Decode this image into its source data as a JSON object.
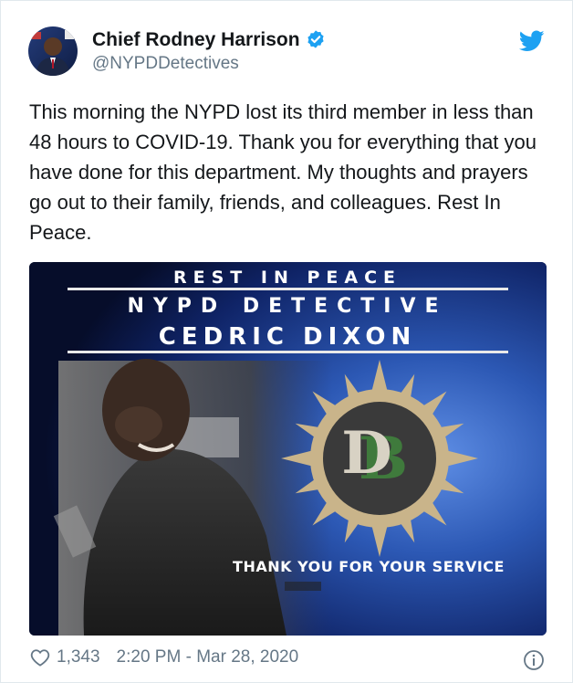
{
  "tweet": {
    "author": {
      "display_name": "Chief Rodney Harrison",
      "handle": "@NYPDDetectives",
      "verified": true,
      "avatar_icon": "profile-photo"
    },
    "brand_icon": "twitter-bird-icon",
    "text": "This morning the NYPD lost its third member in less than 48 hours to COVID-19. Thank you for everything that you have done for this department. My thoughts and prayers go out to their family, friends, and colleagues. Rest In Peace.",
    "media": {
      "line1": "REST IN PEACE",
      "line2": "NYPD DETECTIVE",
      "line3": "CEDRIC DIXON",
      "footer": "THANK YOU FOR YOUR SERVICE",
      "emblem_letters": "DB",
      "colors": {
        "background_dark": "#0b1a4a",
        "background_light": "#3b6fd0",
        "emblem_tan": "#c9b48a",
        "emblem_dark": "#3a3a3a",
        "emblem_green": "#3f7a3c"
      }
    },
    "footer": {
      "like_count": "1,343",
      "timestamp": "2:20 PM - Mar 28, 2020",
      "like_icon": "heart-icon",
      "info_icon": "info-icon"
    },
    "colors": {
      "verified_blue": "#1da1f2",
      "twitter_blue": "#1da1f2",
      "secondary_text": "#657786"
    }
  }
}
